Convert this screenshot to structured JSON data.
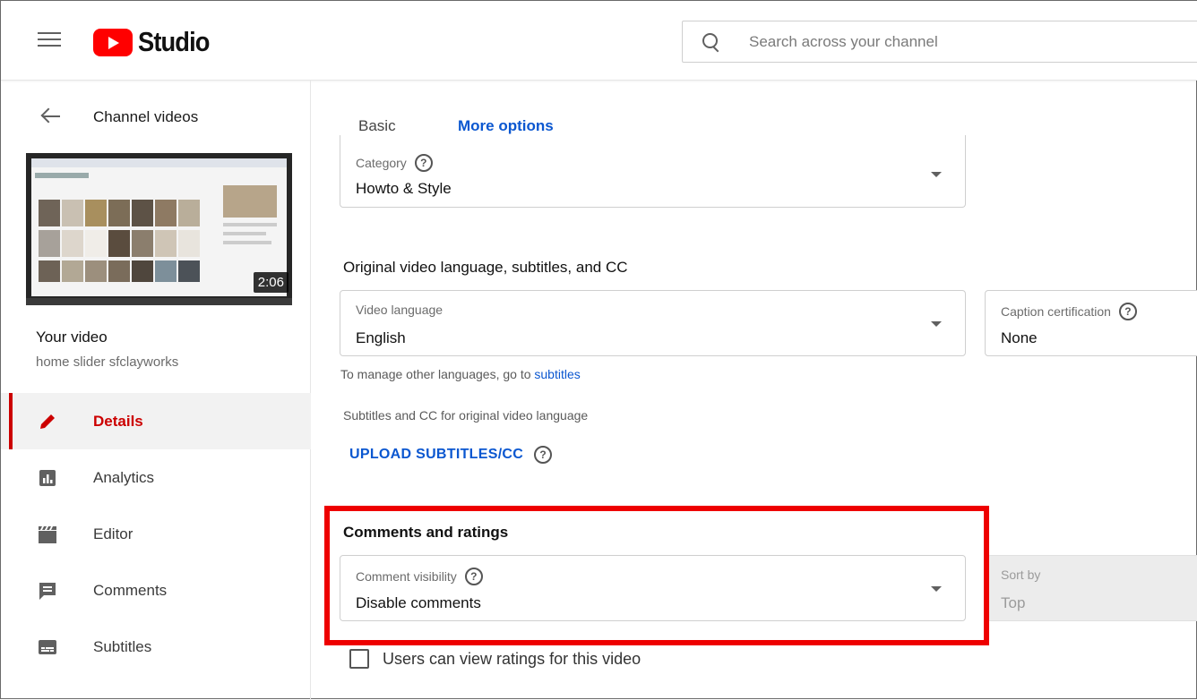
{
  "header": {
    "logo_text": "Studio",
    "search_placeholder": "Search across your channel"
  },
  "sidebar": {
    "back_label": "Channel videos",
    "thumbnail_duration": "2:06",
    "your_video_label": "Your video",
    "video_name": "home slider sfclayworks",
    "nav": [
      {
        "label": "Details",
        "icon": "pencil-icon",
        "active": true
      },
      {
        "label": "Analytics",
        "icon": "analytics-icon",
        "active": false
      },
      {
        "label": "Editor",
        "icon": "clapperboard-icon",
        "active": false
      },
      {
        "label": "Comments",
        "icon": "comment-icon",
        "active": false
      },
      {
        "label": "Subtitles",
        "icon": "subtitles-icon",
        "active": false
      }
    ]
  },
  "tabs": {
    "basic": "Basic",
    "more_options": "More options",
    "active": "More options"
  },
  "category": {
    "label": "Category",
    "value": "Howto & Style"
  },
  "language_section": {
    "title": "Original video language, subtitles, and CC",
    "video_language_label": "Video language",
    "video_language_value": "English",
    "caption_cert_label": "Caption certification",
    "caption_cert_value": "None",
    "manage_text": "To manage other languages, go to",
    "manage_link": "subtitles",
    "subtitles_text": "Subtitles and CC for original video language",
    "upload_button": "UPLOAD SUBTITLES/CC"
  },
  "comments_section": {
    "title": "Comments and ratings",
    "visibility_label": "Comment visibility",
    "visibility_value": "Disable comments",
    "sort_label": "Sort by",
    "sort_value": "Top",
    "ratings_checkbox_label": "Users can view ratings for this video",
    "ratings_checked": false
  },
  "colors": {
    "accent_blue": "#0b57d0",
    "active_red": "#cc0000",
    "highlight_red": "#ee0000"
  }
}
